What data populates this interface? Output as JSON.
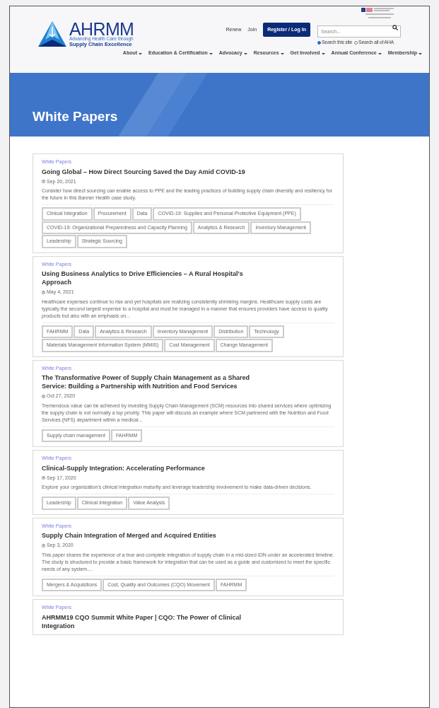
{
  "header": {
    "logo": {
      "name": "AHRMM",
      "tagline_1": "Advancing Health Care through",
      "tagline_2": "Supply Chain Excellence"
    },
    "links": [
      "Renew",
      "Join"
    ],
    "login_button": "Register / Log In",
    "search": {
      "placeholder": "Search..."
    },
    "search_scope": [
      {
        "label": "Search this site",
        "selected": true
      },
      {
        "label": "Search all of AHA",
        "selected": false
      }
    ],
    "nav": [
      "About",
      "Education & Certification",
      "Advocacy",
      "Resources",
      "Get Involved",
      "Annual Conference",
      "Membership"
    ]
  },
  "banner": {
    "title": "White Papers"
  },
  "articles": [
    {
      "category": "White Papers",
      "title": "Going Global – How Direct Sourcing Saved the Day Amid COVID-19",
      "date": "Sep 20, 2021",
      "summary": "Consider how direct sourcing can enable access to PPE and the leading practices of building supply chain diversity and resiliency for the future in this Banner Health case study.",
      "tags": [
        "Clinical Integration",
        "Procurement",
        "Data",
        "COVID-19: Supplies and Personal Protective Equipment (PPE)",
        "COVID-19: Organizational Preparedness and Capacity Planning",
        "Analytics & Research",
        "Inventory Management",
        "Leadership",
        "Strategic Sourcing"
      ]
    },
    {
      "category": "White Papers",
      "title": "Using Business Analytics to Drive Efficiencies – A Rural Hospital's Approach",
      "date": "May 4, 2021",
      "summary": "Healthcare expenses continue to rise and yet hospitals are realizing consistently shrinking margins. Healthcare supply costs are typically the second largest expense to a hospital and must be managed in a manner that ensures providers have access to quality products but also with an emphasis on...",
      "tags": [
        "FAHRMM",
        "Data",
        "Analytics & Research",
        "Inventory Management",
        "Distribution",
        "Technology",
        "Materials Management Information System (MMIS)",
        "Cost Management",
        "Change Management"
      ]
    },
    {
      "category": "White Papers",
      "title": "The Transformative Power of Supply Chain Management as a Shared Service: Building a Partnership with Nutrition and Food Services",
      "date": "Oct 27, 2020",
      "summary": "Tremendous value can be achieved by investing Supply Chain Management (SCM) resources into shared services where optimizing the supply chain is not normally a top priority. This paper will discuss an example where SCM partnered with the Nutrition and Food Services (NFS) department within a medical...",
      "tags": [
        "Supply chain management",
        "FAHRMM"
      ]
    },
    {
      "category": "White Papers",
      "title": "Clinical-Supply Integration: Accelerating Performance",
      "date": "Sep 17, 2020",
      "summary": "Explore your organization's clinical integration maturity and leverage leadership involvement to make data-driven decisions.",
      "tags": [
        "Leadership",
        "Clinical Integration",
        "Value Analysis"
      ]
    },
    {
      "category": "White Papers",
      "title": "Supply Chain Integration of Merged and Acquired Entities",
      "date": "Sep 3, 2020",
      "summary": "This paper shares the experience of a true and complete integration of supply chain in a mid-sized IDN under an accelerated timeline. The study is structured to provide a basic framework for integration that can be used as a guide and customized to meet the specific needs of any system....",
      "tags": [
        "Mergers & Acquisitions",
        "Cost, Quality and Outcomes (CQO) Movement",
        "FAHRMM"
      ]
    },
    {
      "category": "White Papers",
      "title": "AHRMM19 CQO Summit White Paper | CQO: The Power of Clinical Integration"
    }
  ]
}
